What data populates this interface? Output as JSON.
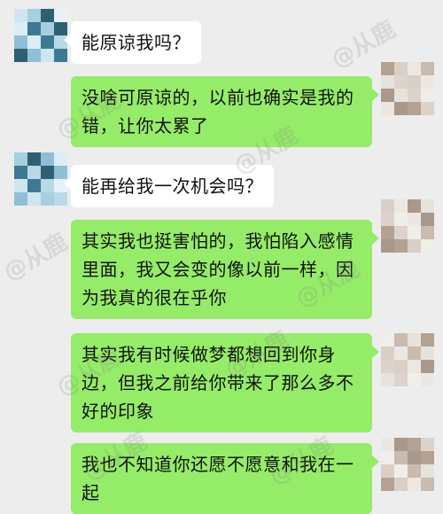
{
  "messages": [
    {
      "side": "left",
      "text": "能原谅我吗？"
    },
    {
      "side": "right",
      "text": "没啥可原谅的，以前也确实是我的错，让你太累了"
    },
    {
      "side": "left",
      "text": "能再给我一次机会吗？"
    },
    {
      "side": "right",
      "text": "其实我也挺害怕的，我怕陷入感情里面，我又会变的像以前一样，因为我真的很在乎你"
    },
    {
      "side": "right",
      "text": "其实我有时候做梦都想回到你身边，但我之前给你带来了那么多不好的印象"
    },
    {
      "side": "right",
      "text": "我也不知道你还愿不愿意和我在一起"
    }
  ],
  "watermark": "@从鹿",
  "colors": {
    "background": "#ededed",
    "incoming_bubble": "#ffffff",
    "outgoing_bubble": "#95ec69"
  }
}
